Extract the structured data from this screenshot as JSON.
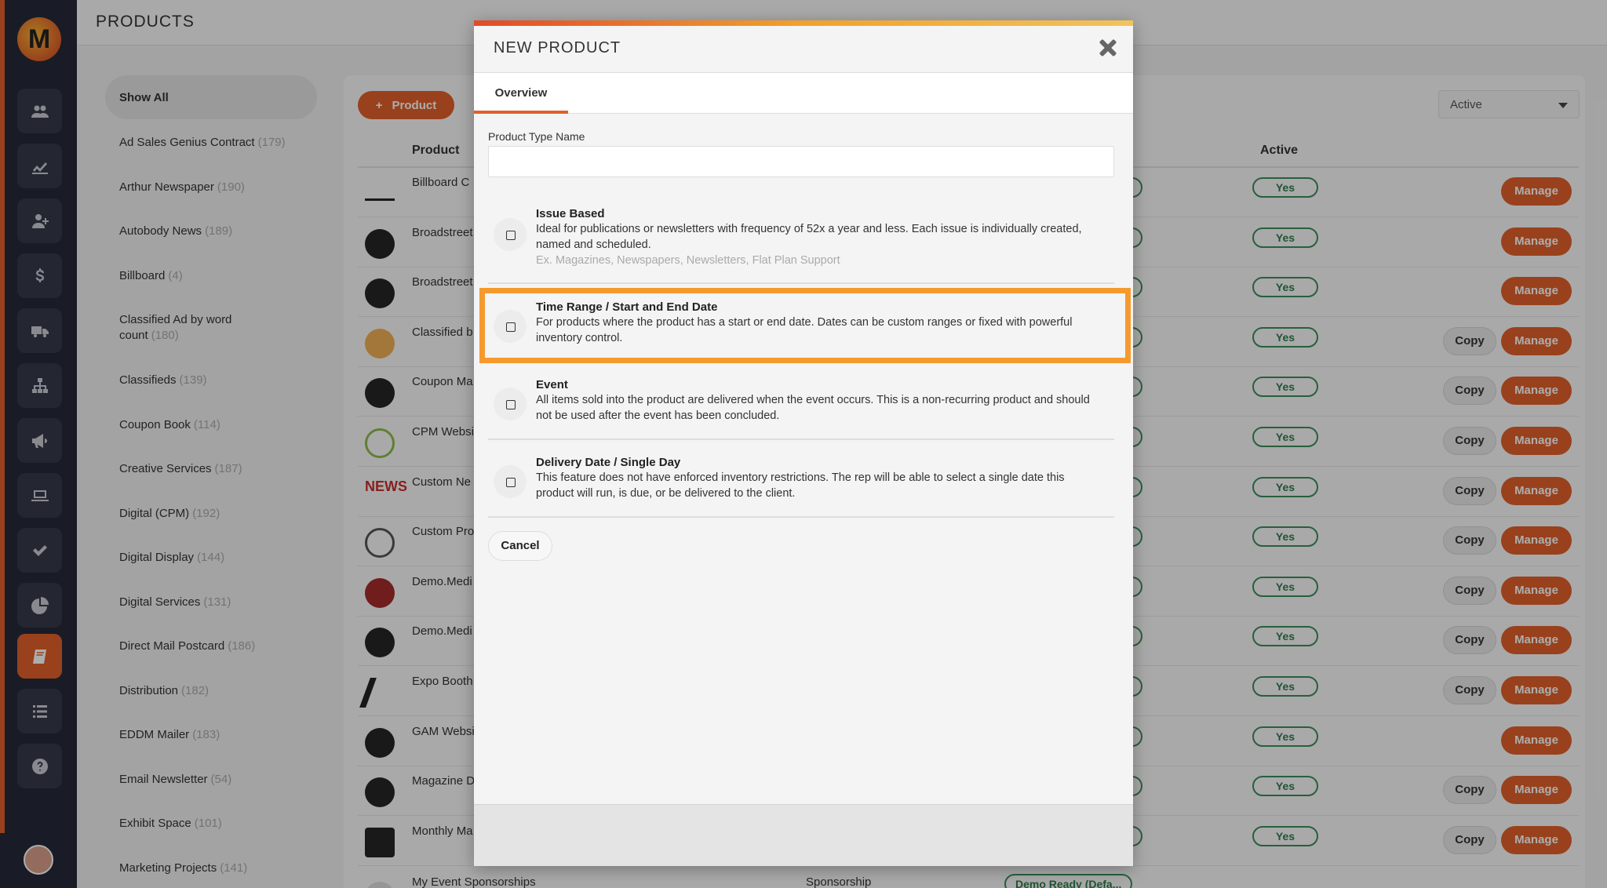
{
  "header": {
    "title": "PRODUCTS"
  },
  "categories": {
    "show_all": "Show All",
    "items": [
      {
        "name": "Ad Sales Genius Contract",
        "count": "(179)"
      },
      {
        "name": "Arthur Newspaper",
        "count": "(190)"
      },
      {
        "name": "Autobody News",
        "count": "(189)"
      },
      {
        "name": "Billboard",
        "count": "(4)"
      },
      {
        "name": "Classified Ad by word count",
        "count": "(180)"
      },
      {
        "name": "Classifieds",
        "count": "(139)"
      },
      {
        "name": "Coupon Book",
        "count": "(114)"
      },
      {
        "name": "Creative Services",
        "count": "(187)"
      },
      {
        "name": "Digital (CPM)",
        "count": "(192)"
      },
      {
        "name": "Digital Display",
        "count": "(144)"
      },
      {
        "name": "Digital Services",
        "count": "(131)"
      },
      {
        "name": "Direct Mail Postcard",
        "count": "(186)"
      },
      {
        "name": "Distribution",
        "count": "(182)"
      },
      {
        "name": "EDDM Mailer",
        "count": "(183)"
      },
      {
        "name": "Email Newsletter",
        "count": "(54)"
      },
      {
        "name": "Exhibit Space",
        "count": "(101)"
      },
      {
        "name": "Marketing Projects",
        "count": "(141)"
      }
    ]
  },
  "toolbar": {
    "add_label": "Product",
    "status_value": "Active"
  },
  "table": {
    "headers": {
      "product": "Product",
      "active": "Active"
    },
    "yes": "Yes",
    "manage": "Manage",
    "copy": "Copy",
    "rows": [
      {
        "name": "Billboard C",
        "copy": false
      },
      {
        "name": "Broadstreet",
        "copy": false
      },
      {
        "name": "Broadstreet",
        "copy": false
      },
      {
        "name": "Classified b",
        "copy": true
      },
      {
        "name": "Coupon Ma",
        "copy": true
      },
      {
        "name": "CPM Websi",
        "copy": true
      },
      {
        "name": "Custom Ne",
        "copy": true
      },
      {
        "name": "Custom Pro",
        "copy": true
      },
      {
        "name": "Demo.Medi",
        "copy": true
      },
      {
        "name": "Demo.Medi",
        "copy": true
      },
      {
        "name": "Expo Booth",
        "copy": true
      },
      {
        "name": "GAM Websi",
        "copy": false
      },
      {
        "name": "Magazine D",
        "copy": true
      },
      {
        "name": "Monthly Ma",
        "copy": true
      }
    ],
    "last_row": {
      "name": "My Event Sponsorships",
      "type": "Sponsorship",
      "tag": "Demo Ready (Defa..."
    }
  },
  "modal": {
    "title": "NEW PRODUCT",
    "tab": "Overview",
    "field_label": "Product Type Name",
    "field_value": "",
    "options": [
      {
        "title": "Issue Based",
        "description": "Ideal for publications or newsletters with frequency of 52x a year and less. Each issue is individually created, named and scheduled.",
        "example": "Ex. Magazines, Newspapers, Newsletters, Flat Plan Support"
      },
      {
        "title": "Time Range / Start and End Date",
        "description": "For products where the product has a start or end date. Dates can be custom ranges or fixed with powerful inventory control."
      },
      {
        "title": "Event",
        "description": "All items sold into the product are delivered when the event occurs. This is a non-recurring product and should not be used after the event has been concluded."
      },
      {
        "title": "Delivery Date / Single Day",
        "description": "This feature does not have enforced inventory restrictions. The rep will be able to select a single date this product will run, is due, or be delivered to the client."
      }
    ],
    "cancel_label": "Cancel"
  },
  "colors": {
    "accent": "#e0612a",
    "highlight": "#f59a2e",
    "rail": "#252a3a",
    "success": "#3c8d5a"
  }
}
